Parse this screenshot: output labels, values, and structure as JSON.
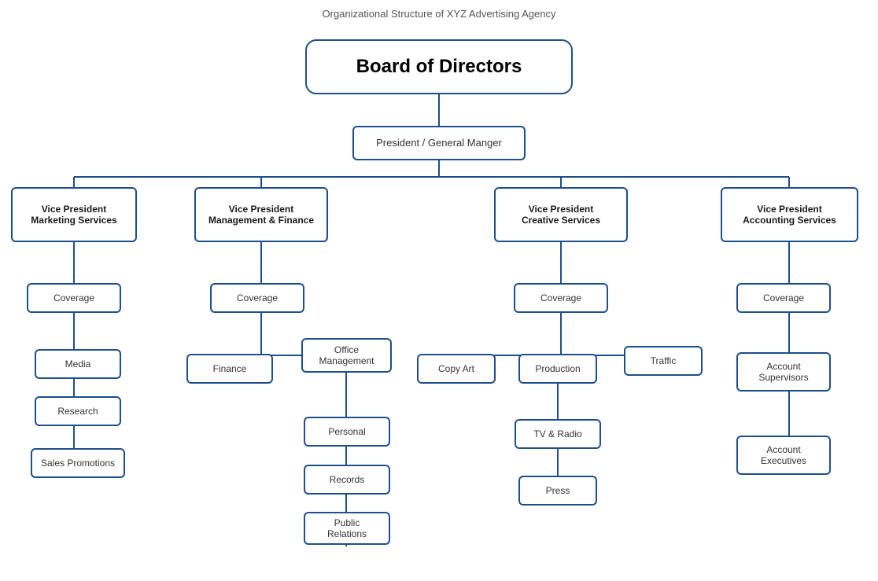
{
  "title": "Organizational Structure of XYZ Advertising Agency",
  "nodes": {
    "board": "Board of Directors",
    "president": "President / General Manger",
    "vp_marketing": "Vice President\nMarketing Services",
    "vp_management": "Vice President\nManagement & Finance",
    "vp_creative": "Vice President\nCreative Services",
    "vp_accounting": "Vice President\nAccounting Services",
    "coverage_marketing": "Coverage",
    "coverage_management": "Coverage",
    "coverage_creative": "Coverage",
    "coverage_accounting": "Coverage",
    "media": "Media",
    "research": "Research",
    "sales_promotions": "Sales Promotions",
    "finance": "Finance",
    "office_management": "Office\nManagement",
    "personal": "Personal",
    "records": "Records",
    "public_relations": "Public\nRelations",
    "copy_art": "Copy Art",
    "production": "Production",
    "traffic": "Traffic",
    "tv_radio": "TV & Radio",
    "press": "Press",
    "account_supervisors": "Account\nSupervisors",
    "account_executives": "Account\nExecutives"
  }
}
